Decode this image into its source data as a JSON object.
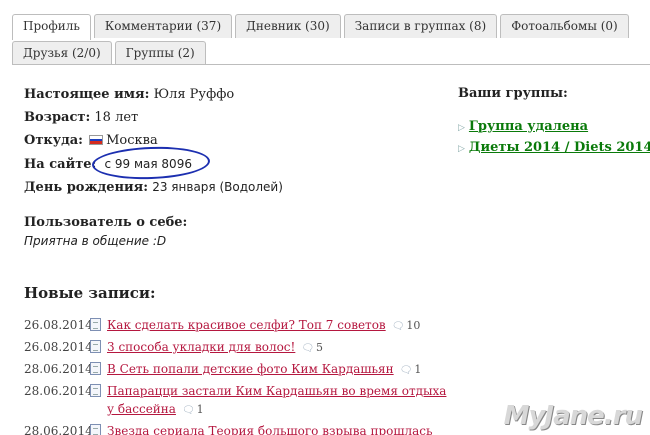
{
  "tabs": {
    "row1": [
      {
        "label": "Профиль",
        "active": true
      },
      {
        "label": "Комментарии (37)",
        "active": false
      },
      {
        "label": "Дневник (30)",
        "active": false
      },
      {
        "label": "Записи в группах (8)",
        "active": false
      },
      {
        "label": "Фотоальбомы (0)",
        "active": false
      }
    ],
    "row2": [
      {
        "label": "Друзья (2/0)",
        "active": false
      },
      {
        "label": "Группы (2)",
        "active": false
      }
    ]
  },
  "profile": {
    "real_name_label": "Настоящее имя:",
    "real_name": "Юля Руффо",
    "age_label": "Возраст:",
    "age": "18 лет",
    "from_label": "Откуда:",
    "from": "Москва",
    "on_site_label": "На сайте:",
    "on_site": "с 99 мая 8096",
    "birthday_label": "День рождения:",
    "birthday": "23 января (Водолей)",
    "flag_colors": [
      "#ffffff",
      "#1c3fbf",
      "#d52b1e"
    ]
  },
  "about": {
    "label": "Пользователь о себе:",
    "text": "Приятна в общение :D"
  },
  "groups": {
    "title": "Ваши группы:",
    "items": [
      "Группа удалена",
      "Диеты 2014 / Diets 2014"
    ]
  },
  "posts": {
    "title": "Новые записи:",
    "items": [
      {
        "date": "26.08.2014",
        "title": "Как сделать красивое селфи? Топ 7 советов",
        "comments": "10"
      },
      {
        "date": "26.08.2014",
        "title": "3 способа укладки для волос!",
        "comments": "5"
      },
      {
        "date": "28.06.2014",
        "title": "В Сеть попали детские фото Ким Кардашьян",
        "comments": "1"
      },
      {
        "date": "28.06.2014",
        "title": "Папарацци застали Ким Кардашьян во время отдыха у бассейна",
        "comments": "1"
      },
      {
        "date": "28.06.2014",
        "title": "Звезда сериала Теория большого взрыва прошлась",
        "comments": ""
      }
    ]
  },
  "watermark": "MyJane.ru"
}
